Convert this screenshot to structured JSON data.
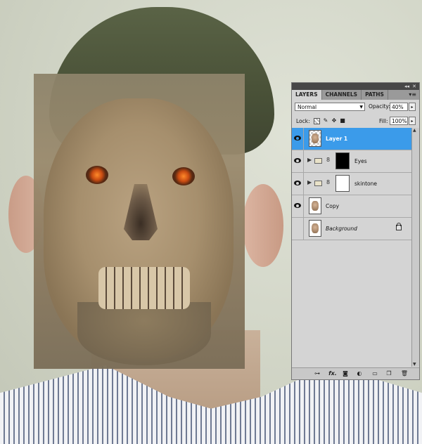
{
  "panel": {
    "tabs": [
      {
        "label": "LAYERS",
        "active": true
      },
      {
        "label": "CHANNELS",
        "active": false
      },
      {
        "label": "PATHS",
        "active": false
      }
    ],
    "blend_mode": "Normal",
    "opacity_label": "Opacity:",
    "opacity_value": "40%",
    "lock_label": "Lock:",
    "fill_label": "Fill:",
    "fill_value": "100%",
    "layers": [
      {
        "name": "Layer 1",
        "visible": true,
        "selected": true
      },
      {
        "name": "Eyes",
        "visible": true,
        "type": "group",
        "mask": "black"
      },
      {
        "name": "skintone",
        "visible": true,
        "type": "group",
        "mask": "white"
      },
      {
        "name": "Copy",
        "visible": true
      },
      {
        "name": "Background",
        "visible": false,
        "locked": true
      }
    ]
  },
  "icons": {
    "panel": [
      "collapse-icon",
      "close-icon",
      "panel-menu-icon"
    ],
    "lock": [
      "lock-transparent-icon",
      "lock-brush-icon",
      "lock-move-icon",
      "lock-all-icon"
    ],
    "bottom": [
      "link-icon",
      "fx-icon",
      "mask-icon",
      "adjust-icon",
      "group-icon",
      "new-layer-icon",
      "trash-icon"
    ]
  },
  "colors": {
    "selection": "#3b9bea",
    "panel_bg": "#d4d4d4",
    "eye_glow": "#ff8a2a"
  }
}
